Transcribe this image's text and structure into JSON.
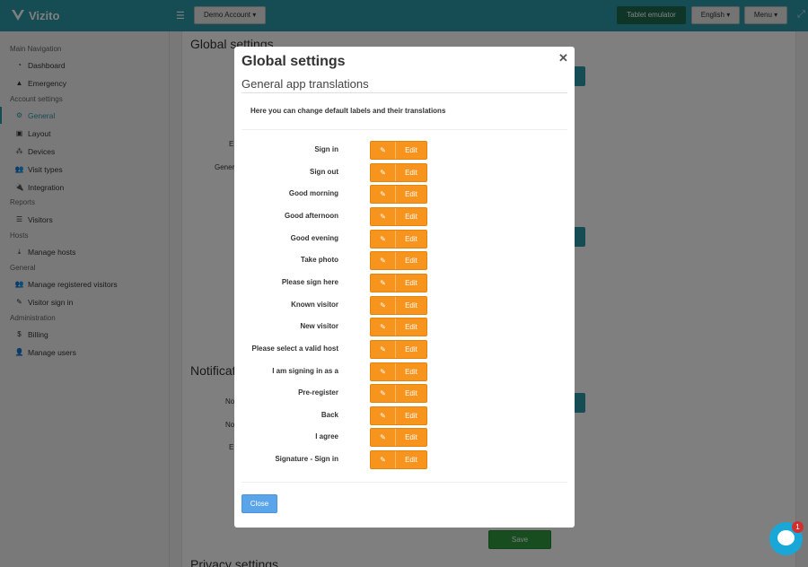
{
  "topbar": {
    "brand": "Vizito",
    "account_button": "Demo Account ▾",
    "tablet_button": "Tablet emulator",
    "language_button": "English ▾",
    "menu_button": "Menu ▾"
  },
  "sidebar": {
    "sections": [
      {
        "title": "Main Navigation",
        "items": [
          {
            "label": "Dashboard",
            "icon": "clock-icon"
          },
          {
            "label": "Emergency",
            "icon": "warning-icon"
          }
        ]
      },
      {
        "title": "Account settings",
        "items": [
          {
            "label": "General",
            "icon": "gear-icon",
            "active": true
          },
          {
            "label": "Layout",
            "icon": "image-icon"
          },
          {
            "label": "Devices",
            "icon": "sitemap-icon"
          },
          {
            "label": "Visit types",
            "icon": "users-icon"
          },
          {
            "label": "Integration",
            "icon": "plug-icon"
          }
        ]
      },
      {
        "title": "Reports",
        "items": [
          {
            "label": "Visitors",
            "icon": "list-icon"
          }
        ]
      },
      {
        "title": "Hosts",
        "items": [
          {
            "label": "Manage hosts",
            "icon": "download-icon"
          }
        ]
      },
      {
        "title": "General",
        "items": [
          {
            "label": "Manage registered visitors",
            "icon": "users-icon"
          },
          {
            "label": "Visitor sign in",
            "icon": "pencil-icon"
          }
        ]
      },
      {
        "title": "Administration",
        "items": [
          {
            "label": "Billing",
            "icon": "dollar-icon"
          },
          {
            "label": "Manage users",
            "icon": "user-plus-icon"
          }
        ]
      }
    ]
  },
  "background": {
    "global_heading": "Global settings",
    "notifications_heading": "Notificati",
    "privacy_heading": "Privacy settings",
    "fragments": [
      "E",
      "Gener",
      "No",
      "No",
      "E"
    ],
    "save_button": "Save"
  },
  "modal": {
    "title": "Global settings",
    "subtitle": "General app translations",
    "description": "Here you can change default labels and their translations",
    "edit_label": "Edit",
    "close_button": "Close",
    "rows": [
      "Sign in",
      "Sign out",
      "Good morning",
      "Good afternoon",
      "Good evening",
      "Take photo",
      "Please sign here",
      "Known visitor",
      "New visitor",
      "Please select a valid host",
      "I am signing in as a",
      "Pre-register",
      "Back",
      "I agree",
      "Signature - Sign in"
    ]
  },
  "chat": {
    "badge_count": "1"
  },
  "colors": {
    "topbar": "#2c98a6",
    "accent": "#2c98a6",
    "edit_button": "#f7941d",
    "close_button": "#5aa4ea",
    "save_button": "#2e9b3e",
    "tablet_button": "#1f6b51",
    "chat": "#18a7d6"
  }
}
